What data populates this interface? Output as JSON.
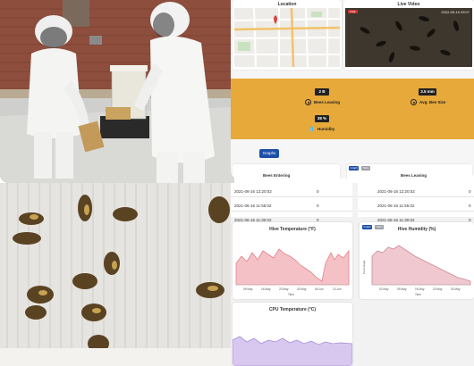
{
  "top_panel": {
    "location_title": "Location",
    "live_video_title": "Live Video",
    "live_badge": "LIVE",
    "video_timestamp": "2022-05-15 09:07",
    "stats": [
      {
        "value": "2 B",
        "label": "Bees Leaving",
        "icon": "target-icon"
      },
      {
        "value": "3.5 mm",
        "label": "Avg. Bee Size",
        "icon": "target-icon"
      },
      {
        "value": "38 %",
        "label": "Humidity",
        "icon": "water-drops-icon"
      }
    ],
    "graphs_button": "Graphs",
    "tab_graph": "Graph",
    "tab_table": "Table",
    "bees_entering_title": "Bees Entering",
    "bees_leaving_title": "Bees Leaving",
    "accent_color": "#e7a93a",
    "button_color": "#1d4fa8"
  },
  "tables": {
    "left_rows": [
      {
        "time": "2021-06-16 12:20:02",
        "value": "0"
      },
      {
        "time": "2021-06-16 11:55:02",
        "value": "0"
      },
      {
        "time": "2021-06-16 11:30:02",
        "value": "0"
      }
    ],
    "right_rows": [
      {
        "time": "2021-06-16 12:20:02",
        "value": "0"
      },
      {
        "time": "2021-06-16 11:55:02",
        "value": "0"
      },
      {
        "time": "2021-06-16 11:30:02",
        "value": "0"
      }
    ]
  },
  "charts": {
    "hive_temperature": {
      "title": "Hive Temperature (°F)",
      "xlabel": "Time",
      "ylabel": "",
      "ticks": [
        "09 May",
        "16 May",
        "23 May",
        "30 May",
        "06 Jun",
        "13 Jun"
      ],
      "color": "#e57e8a"
    },
    "hive_humidity": {
      "title": "Hive Humidity (%)",
      "xlabel": "Time",
      "ylabel": "Percentage",
      "ticks": [
        "02 May",
        "09 May",
        "16 May",
        "23 May",
        "30 May"
      ],
      "color": "#c98a99",
      "tab_graph": "Graph",
      "tab_table": "Table"
    },
    "cpu_temperature": {
      "title": "CPU Temperature (°C)",
      "color": "#a78bd9"
    }
  }
}
